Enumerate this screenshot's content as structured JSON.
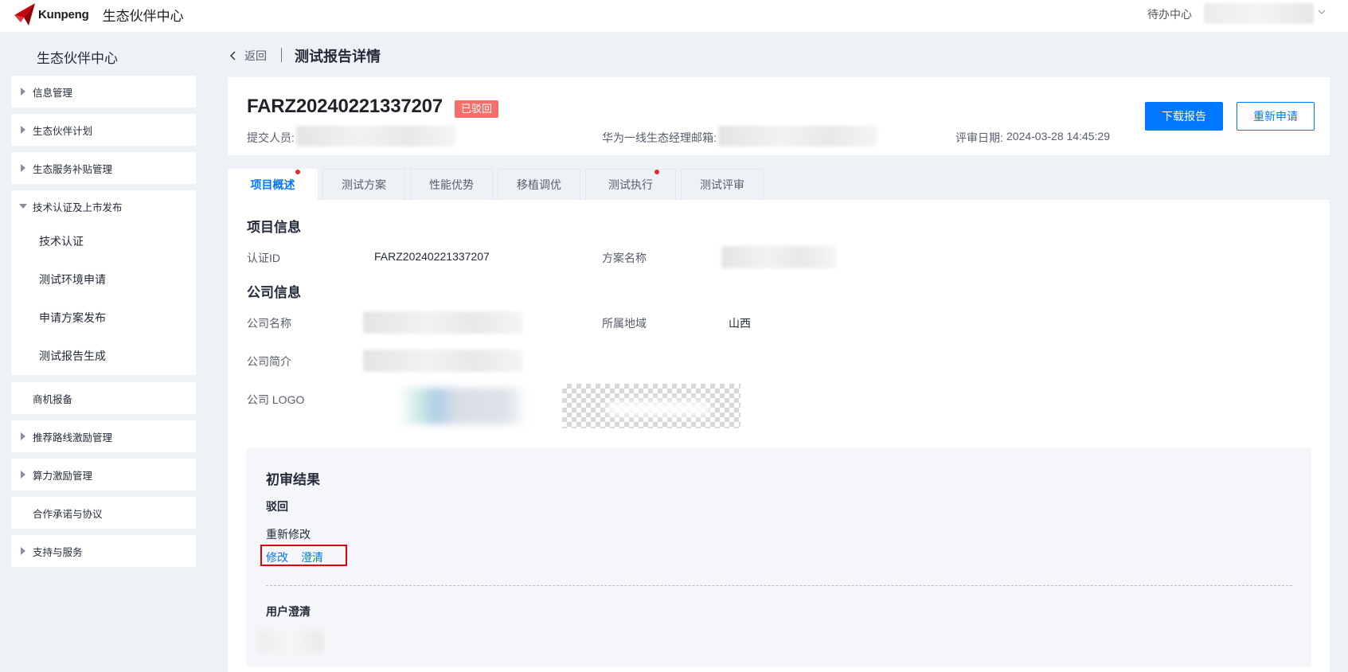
{
  "topbar": {
    "brand": "Kunpeng",
    "app_title": "生态伙伴中心",
    "todo": "待办中心"
  },
  "sidebar": {
    "title": "生态伙伴中心",
    "items": [
      {
        "label": "信息管理"
      },
      {
        "label": "生态伙伴计划"
      },
      {
        "label": "生态服务补贴管理"
      },
      {
        "label": "技术认证及上市发布",
        "children": [
          "技术认证",
          "测试环境申请",
          "申请方案发布",
          "测试报告生成"
        ]
      },
      {
        "label": "商机报备"
      },
      {
        "label": "推荐路线激励管理"
      },
      {
        "label": "算力激励管理"
      },
      {
        "label": "合作承诺与协议"
      },
      {
        "label": "支持与服务"
      }
    ]
  },
  "header": {
    "back": "返回",
    "page_title": "测试报告详情"
  },
  "report": {
    "id": "FARZ20240221337207",
    "status": "已驳回",
    "submitter_label": "提交人员:",
    "manager_email_label": "华为一线生态经理邮箱:",
    "review_date_label": "评审日期:",
    "review_date": "2024-03-28 14:45:29",
    "download_button": "下载报告",
    "reapply_button": "重新申请"
  },
  "tabs": [
    {
      "label": "项目概述",
      "active": true,
      "dot": true
    },
    {
      "label": "测试方案",
      "active": false,
      "dot": false
    },
    {
      "label": "性能优势",
      "active": false,
      "dot": false
    },
    {
      "label": "移植调优",
      "active": false,
      "dot": false
    },
    {
      "label": "测试执行",
      "active": false,
      "dot": true
    },
    {
      "label": "测试评审",
      "active": false,
      "dot": false
    }
  ],
  "project_info": {
    "title": "项目信息",
    "cert_id_label": "认证ID",
    "cert_id": "FARZ20240221337207",
    "solution_name_label": "方案名称"
  },
  "company_info": {
    "title": "公司信息",
    "name_label": "公司名称",
    "region_label": "所属地域",
    "region": "山西",
    "intro_label": "公司简介",
    "logo_label": "公司 LOGO"
  },
  "review": {
    "title": "初审结果",
    "status": "驳回",
    "comment": "重新修改",
    "modify_link": "修改",
    "clarify_link": "澄清",
    "user_clarify_title": "用户澄清"
  },
  "colors": {
    "primary": "#0077ff",
    "rejected_badge": "#f66f6a",
    "highlight_box": "#e0000e",
    "tab_dot": "#e42b2b"
  }
}
